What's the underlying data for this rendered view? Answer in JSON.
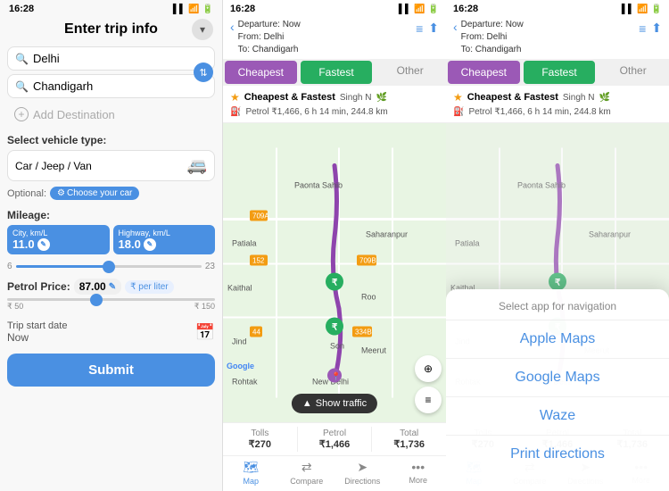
{
  "panel1": {
    "status_time": "16:28",
    "header_title": "Enter trip info",
    "from_placeholder": "Delhi",
    "to_placeholder": "Chandigarh",
    "add_destination": "Add Destination",
    "vehicle_section_label": "Select vehicle type:",
    "vehicle_type": "Car / Jeep / Van",
    "optional_label": "Optional:",
    "choose_car_label": "Choose your car",
    "mileage_label": "Mileage:",
    "city_label": "City, km/L",
    "highway_label": "Highway, km/L",
    "city_value": "11.0",
    "highway_value": "18.0",
    "slider_min": "6",
    "slider_max": "23",
    "petrol_price_label": "Petrol Price:",
    "petrol_price_value": "87.00",
    "per_liter": "₹ per liter",
    "price_min": "₹ 50",
    "price_max": "₹ 150",
    "trip_date_label": "Trip start date",
    "trip_date_value": "Now",
    "submit_label": "Submit"
  },
  "panel2": {
    "status_time": "16:28",
    "departure_label": "Departure: Now",
    "from_label": "From: Delhi",
    "to_label": "To: Chandigarh",
    "tabs": [
      "Cheapest",
      "Fastest",
      "Other"
    ],
    "active_tab": "Fastest",
    "route1_label": "Cheapest & Fastest",
    "route1_detail": "Singh N",
    "route2_detail": "Petrol ₹1,466, 6 h 14 min, 244.8 km",
    "show_traffic": "Show traffic",
    "google": "Google",
    "summary_tolls_label": "Tolls",
    "summary_tolls_value": "₹270",
    "summary_petrol_label": "Petrol",
    "summary_petrol_value": "₹1,466",
    "summary_total_label": "Total",
    "summary_total_value": "₹1,736",
    "nav_items": [
      "Map",
      "Compare",
      "Directions",
      "More"
    ]
  },
  "panel3": {
    "status_time": "16:28",
    "departure_label": "Departure: Now",
    "from_label": "From: Delhi",
    "to_label": "To: Chandigarh",
    "tabs": [
      "Cheapest",
      "Fastest",
      "Other"
    ],
    "active_tab": "Fastest",
    "modal_title": "Select app for navigation",
    "modal_options": [
      "Apple Maps",
      "Google Maps",
      "Waze",
      "Print directions"
    ]
  },
  "icons": {
    "search": "🔍",
    "swap": "⇅",
    "plus": "+",
    "truck": "🚐",
    "car": "🚗",
    "gear": "⚙",
    "calendar": "📅",
    "back": "‹",
    "star": "★",
    "fuel": "⛽",
    "map_marker": "📍",
    "rupee": "₹",
    "traffic": "▲",
    "menu": "≡",
    "compass": "⊕",
    "edit": "✎",
    "settings": "≡",
    "share": "⬆",
    "map": "🗺",
    "compare": "⇄",
    "directions": "➤",
    "more": "•••"
  },
  "colors": {
    "primary": "#4a90e2",
    "purple": "#9b59b6",
    "green": "#27ae60",
    "orange": "#f39c12",
    "dark": "#333333",
    "light_bg": "#f8f8f8",
    "map_green": "#e8f5e3"
  }
}
